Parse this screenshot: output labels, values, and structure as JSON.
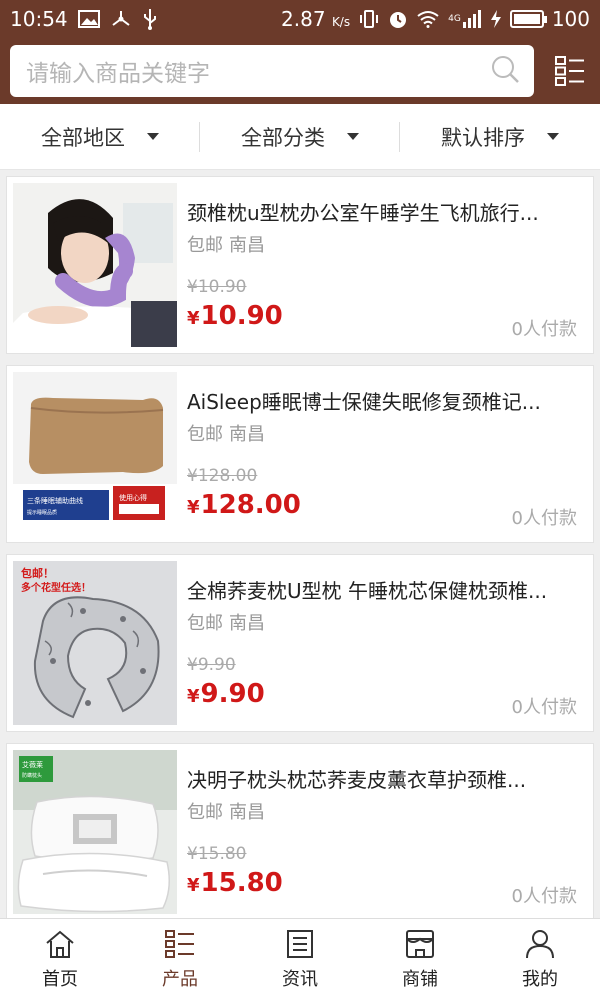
{
  "statusbar": {
    "time": "10:54",
    "speed": "2.87",
    "speed_unit": "K/s",
    "network": "4G",
    "battery": "100",
    "battery_level": 1.0
  },
  "search": {
    "placeholder": "请输入商品关键字"
  },
  "filters": [
    {
      "label": "全部地区"
    },
    {
      "label": "全部分类"
    },
    {
      "label": "默认排序"
    }
  ],
  "products": [
    {
      "title": "颈椎枕u型枕办公室午睡学生飞机旅行...",
      "shipping": "包邮",
      "city": "南昌",
      "old_price": "¥10.90",
      "currency": "¥",
      "price": "10.90",
      "sold": "0人付款"
    },
    {
      "title": "AiSleep睡眠博士保健失眠修复颈椎记...",
      "shipping": "包邮",
      "city": "南昌",
      "old_price": "¥128.00",
      "currency": "¥",
      "price": "128.00",
      "sold": "0人付款",
      "thumb_text": {
        "blue": "三条睡眠辅助曲线",
        "blue_sub": "提示睡眠品质",
        "red": "使用心得"
      }
    },
    {
      "title": "全棉荞麦枕U型枕 午睡枕芯保健枕颈椎...",
      "shipping": "包邮",
      "city": "南昌",
      "old_price": "¥9.90",
      "currency": "¥",
      "price": "9.90",
      "sold": "0人付款",
      "thumb_text": {
        "line1": "包邮！",
        "line2": "多个花型任选！"
      }
    },
    {
      "title": "决明子枕头枕芯荞麦皮薰衣草护颈椎...",
      "shipping": "包邮",
      "city": "南昌",
      "old_price": "¥15.80",
      "currency": "¥",
      "price": "15.80",
      "sold": "0人付款",
      "thumb_text": {
        "badge": "艾薇莱",
        "badge_sub": "防螨枕头"
      }
    }
  ],
  "tabs": [
    {
      "label": "首页",
      "icon": "home-icon"
    },
    {
      "label": "产品",
      "icon": "list-icon"
    },
    {
      "label": "资讯",
      "icon": "news-icon"
    },
    {
      "label": "商铺",
      "icon": "store-icon"
    },
    {
      "label": "我的",
      "icon": "user-icon"
    }
  ],
  "colors": {
    "brand": "#6b3a2a",
    "price": "#d01818",
    "active_tab": "#6b3a2a"
  }
}
